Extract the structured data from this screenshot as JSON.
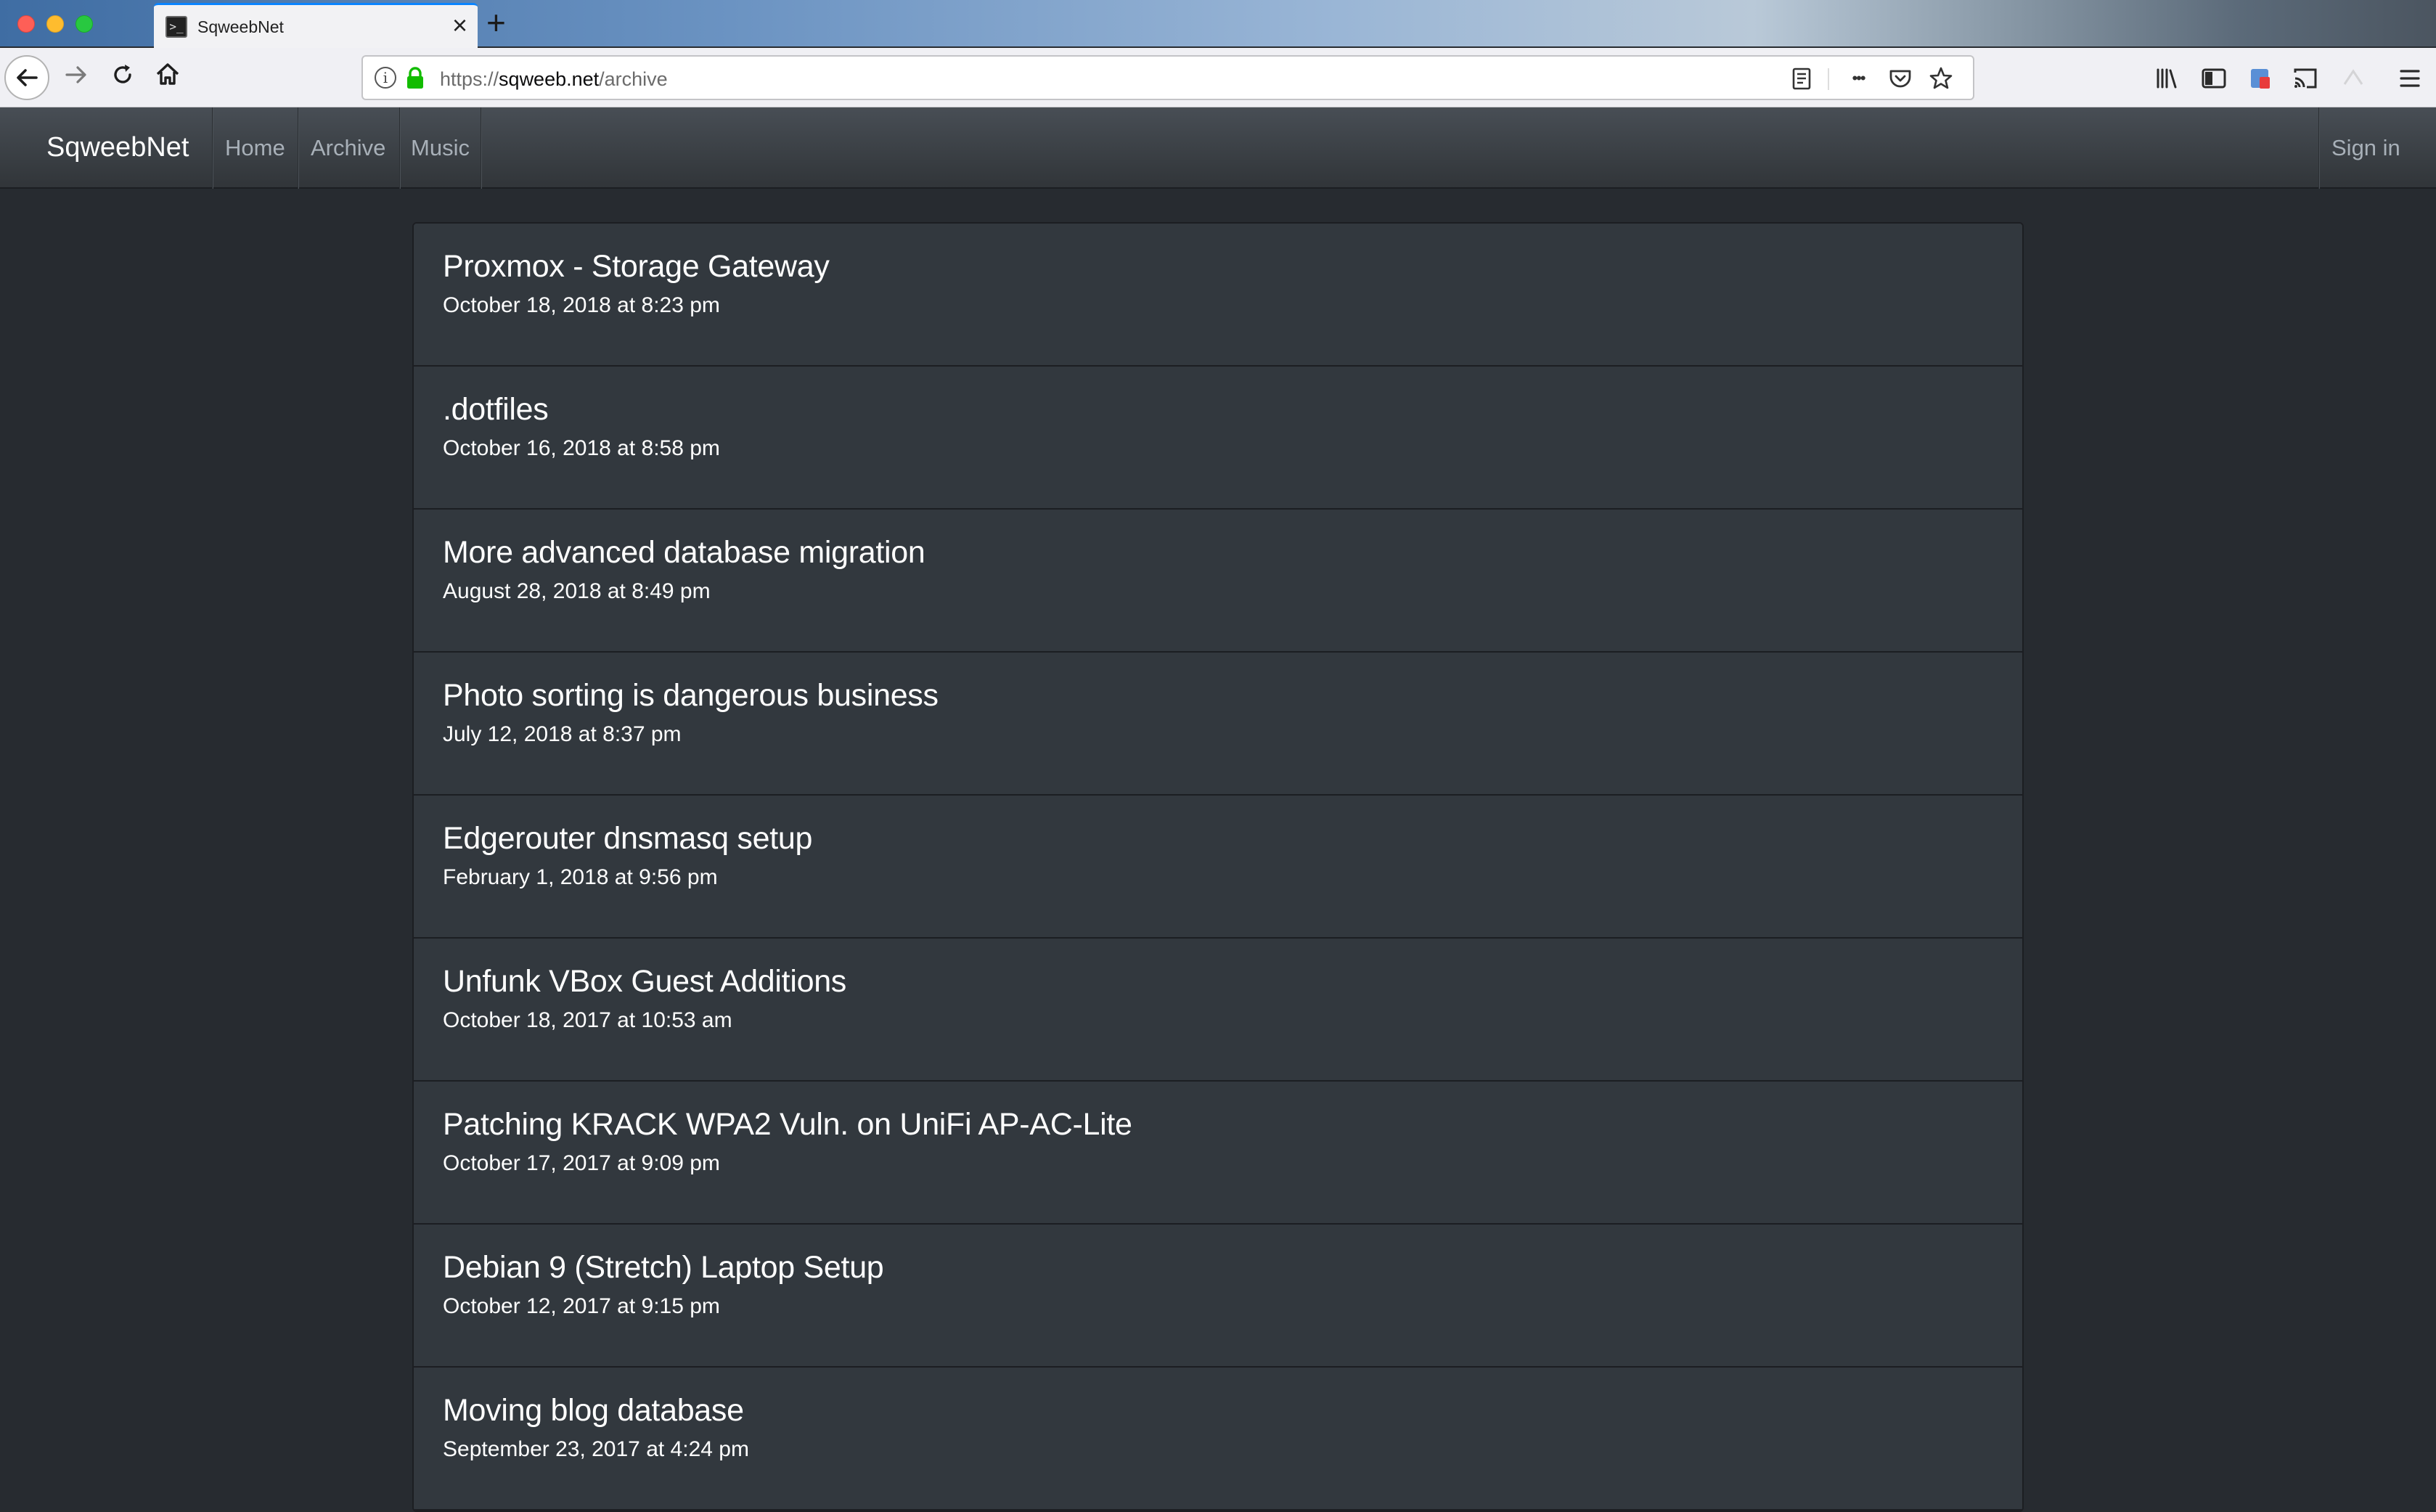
{
  "browser": {
    "tab_title": "SqweebNet",
    "tab_favicon_glyph": ">_",
    "url_scheme": "https://",
    "url_host": "sqweeb.net",
    "url_path": "/archive",
    "more_glyph": "•••"
  },
  "colors": {
    "page_background": "#272b30",
    "navbar_background": "#3a3f44",
    "card_background": "#32383e",
    "lock_green": "#12bc00",
    "tab_accent": "#0a84ff"
  },
  "site": {
    "brand": "SqweebNet",
    "nav": {
      "home": "Home",
      "archive": "Archive",
      "music": "Music",
      "sign_in": "Sign in"
    }
  },
  "posts": [
    {
      "title": "Proxmox - Storage Gateway",
      "date": "October 18, 2018 at 8:23 pm"
    },
    {
      "title": ".dotfiles",
      "date": "October 16, 2018 at 8:58 pm"
    },
    {
      "title": "More advanced database migration",
      "date": "August 28, 2018 at 8:49 pm"
    },
    {
      "title": "Photo sorting is dangerous business",
      "date": "July 12, 2018 at 8:37 pm"
    },
    {
      "title": "Edgerouter dnsmasq setup",
      "date": "February 1, 2018 at 9:56 pm"
    },
    {
      "title": "Unfunk VBox Guest Additions",
      "date": "October 18, 2017 at 10:53 am"
    },
    {
      "title": "Patching KRACK WPA2 Vuln. on UniFi AP-AC-Lite",
      "date": "October 17, 2017 at 9:09 pm"
    },
    {
      "title": "Debian 9 (Stretch) Laptop Setup",
      "date": "October 12, 2017 at 9:15 pm"
    },
    {
      "title": "Moving blog database",
      "date": "September 23, 2017 at 4:24 pm"
    }
  ]
}
